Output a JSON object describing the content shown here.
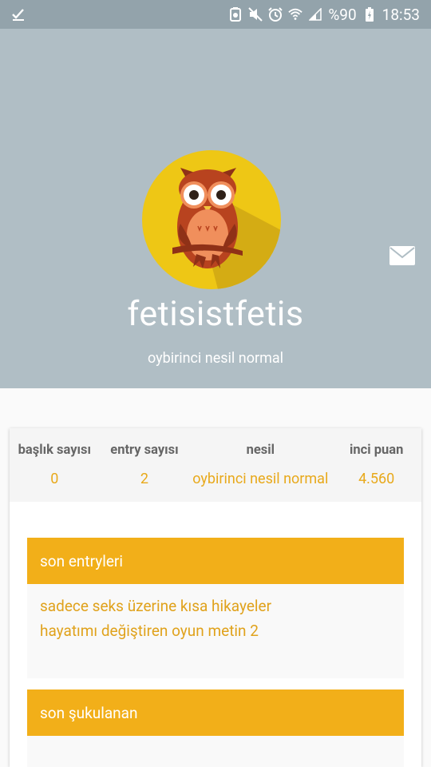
{
  "status_bar": {
    "left_icon": "download-done-icon",
    "battery_percent": "%90",
    "time": "18:53"
  },
  "profile": {
    "username": "fetisistfetis",
    "subtitle": "oybirinci nesil normal",
    "avatar_icon": "owl-avatar",
    "message_icon": "mail-icon"
  },
  "stats": [
    {
      "label": "başlık sayısı",
      "value": "0"
    },
    {
      "label": "entry sayısı",
      "value": "2"
    },
    {
      "label": "nesil",
      "value": "oybirinci nesil normal"
    },
    {
      "label": "inci puan",
      "value": "4.560"
    }
  ],
  "sections": {
    "recent_entries": {
      "title": "son entryleri",
      "items": [
        "sadece seks üzerine kısa hikayeler",
        "hayatımı değiştiren oyun metin 2"
      ]
    },
    "recent_likes": {
      "title": "son şukulanan",
      "items": []
    }
  },
  "colors": {
    "header_bg": "#b0bec5",
    "accent": "#f2af19",
    "value_text": "#e8a91b"
  }
}
